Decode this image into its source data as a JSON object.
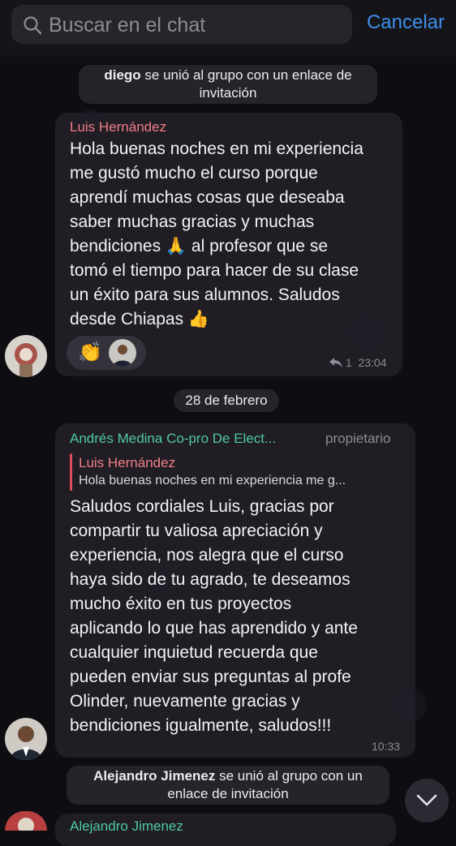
{
  "search": {
    "placeholder": "Buscar en el chat",
    "cancel_label": "Cancelar"
  },
  "service_messages": [
    {
      "name": "diego",
      "text": " se unió al grupo con un enlace de invitación"
    },
    {
      "name": "Alejandro Jimenez",
      "text": " se unió al grupo con un enlace de invitación"
    }
  ],
  "messages": [
    {
      "sender": "Luis Hernández",
      "sender_color": "#f07f86",
      "text": "Hola buenas noches en mi experiencia\nme gustó mucho el curso porque\naprendí muchas cosas que deseaba\nsaber muchas gracias y muchas\nbendiciones 🙏 al profesor que se\ntomó el tiempo para hacer de su clase\nun éxito para sus alumnos. Saludos\ndesde Chiapas 👍",
      "reaction_emoji": "👏",
      "reply_count": "1",
      "time": "23:04"
    },
    {
      "sender": "Andrés Medina Co-pro De Elect...",
      "sender_color": "#4fc9a4",
      "role": "propietario",
      "reply_to_sender": "Luis Hernández",
      "reply_to_text": "Hola buenas noches en mi experiencia me g...",
      "text": "Saludos cordiales Luis, gracias por\ncompartir tu valiosa apreciación y\nexperiencia, nos alegra que el curso\nhaya sido de tu agrado, te deseamos\nmucho éxito en tus proyectos\naplicando lo que has aprendido y ante\ncualquier inquietud recuerda que\npueden enviar sus preguntas al profe\nOlinder, nuevamente gracias y\nbendiciones igualmente, saludos!!!",
      "time": "10:33"
    },
    {
      "sender": "Alejandro Jimenez",
      "sender_color": "#4fc9a4"
    }
  ],
  "date_separator": "28 de febrero",
  "icons": {
    "search": "search-icon",
    "reply": "reply-arrow-icon",
    "scroll_down": "chevron-down-icon"
  },
  "colors": {
    "accent": "#3d8fe8",
    "bubble": "#221e26"
  }
}
